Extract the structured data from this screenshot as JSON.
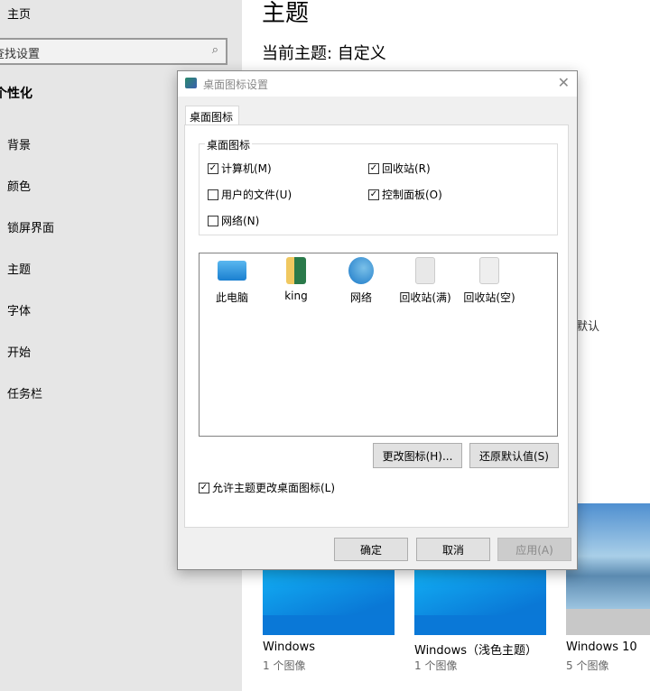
{
  "sidebar": {
    "home": "主页",
    "search_placeholder": "查找设置",
    "section": "个性化",
    "items": [
      "背景",
      "颜色",
      "锁屏界面",
      "主题",
      "字体",
      "开始",
      "任务栏"
    ]
  },
  "main": {
    "title": "主题",
    "current_theme": "当前主题: 自定义",
    "partial_text": "默认",
    "themes": [
      {
        "name": "Windows",
        "count": "1 个图像"
      },
      {
        "name": "Windows（浅色主题）",
        "count": "1 个图像"
      },
      {
        "name": "Windows 10",
        "count": "5 个图像"
      }
    ]
  },
  "dialog": {
    "title": "桌面图标设置",
    "tab": "桌面图标",
    "group_label": "桌面图标",
    "checkboxes": [
      {
        "label": "计算机(M)",
        "checked": true
      },
      {
        "label": "回收站(R)",
        "checked": true
      },
      {
        "label": "用户的文件(U)",
        "checked": false
      },
      {
        "label": "控制面板(O)",
        "checked": true
      },
      {
        "label": "网络(N)",
        "checked": false
      }
    ],
    "icons": [
      "此电脑",
      "king",
      "网络",
      "回收站(满)",
      "回收站(空)"
    ],
    "change_icon": "更改图标(H)...",
    "restore_default": "还原默认值(S)",
    "allow_themes": {
      "label": "允许主题更改桌面图标(L)",
      "checked": true
    },
    "ok": "确定",
    "cancel": "取消",
    "apply": "应用(A)"
  }
}
